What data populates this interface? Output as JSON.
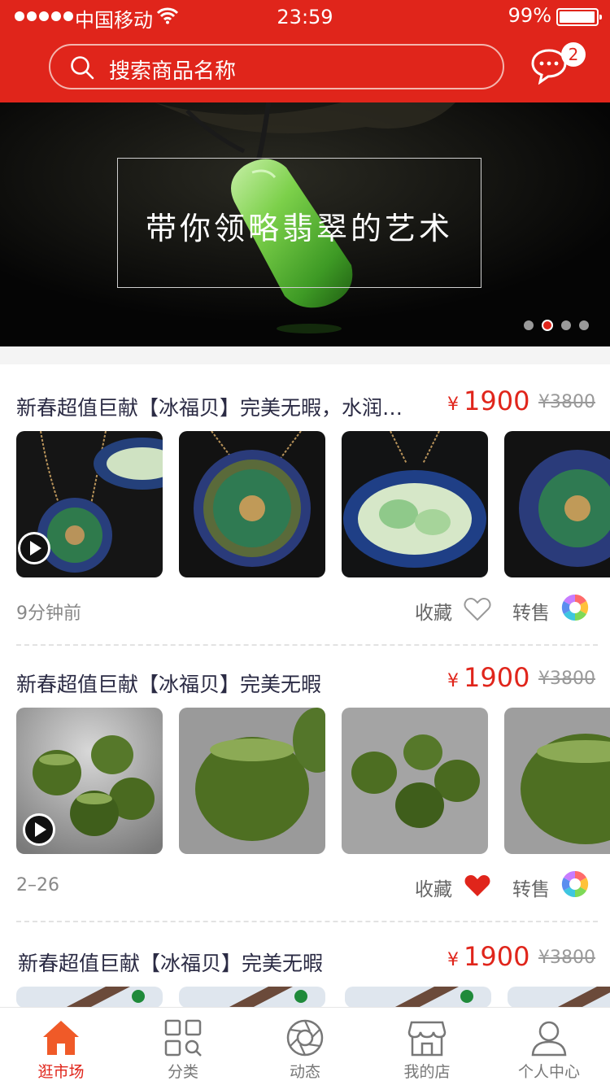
{
  "status_bar": {
    "carrier": "中国移动",
    "time": "23:59",
    "battery": "99%"
  },
  "header": {
    "search_placeholder": "搜索商品名称",
    "message_badge": "2",
    "brand_color": "#e0251b"
  },
  "banner": {
    "title": "带你领略翡翠的艺术",
    "page_count": 4,
    "active_page": 1
  },
  "feed": [
    {
      "title": "新春超值巨献【冰福贝】完美无暇，水润…",
      "currency": "¥",
      "price": "1900",
      "original_price": "¥3800",
      "time": "9分钟前",
      "favorite_label": "收藏",
      "favorited": false,
      "resell_label": "转售",
      "has_video": true,
      "image_kind": "jade-pendant"
    },
    {
      "title": "新春超值巨献【冰福贝】完美无暇",
      "currency": "¥",
      "price": "1900",
      "original_price": "¥3800",
      "time": "2–26",
      "favorite_label": "收藏",
      "favorited": true,
      "resell_label": "转售",
      "has_video": true,
      "image_kind": "jade-jars"
    },
    {
      "title": "新春超值巨献【冰福贝】完美无暇",
      "currency": "¥",
      "price": "1900",
      "original_price": "¥3800",
      "image_kind": "jade-bracelet"
    }
  ],
  "tabbar": [
    {
      "label": "逛市场",
      "icon": "home-icon",
      "active": true
    },
    {
      "label": "分类",
      "icon": "category-icon",
      "active": false
    },
    {
      "label": "动态",
      "icon": "aperture-icon",
      "active": false
    },
    {
      "label": "我的店",
      "icon": "shop-icon",
      "active": false
    },
    {
      "label": "个人中心",
      "icon": "user-icon",
      "active": false
    }
  ]
}
